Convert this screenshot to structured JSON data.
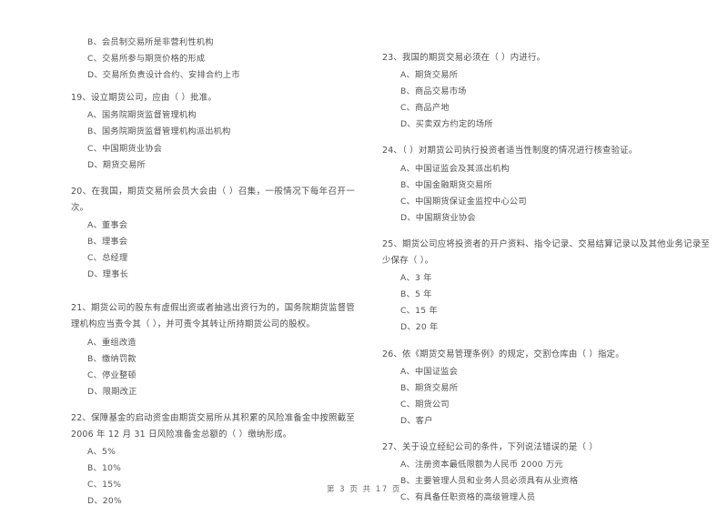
{
  "document": {
    "footer": "第 3 页 共 17 页"
  },
  "left_column": {
    "orphan_options": [
      "B、会员制交易所是非营利性机构",
      "C、交易所参与期货价格的形成",
      "D、交易所负责设计合约、安排合约上市"
    ],
    "questions": [
      {
        "number": "19",
        "stem": "19、设立期货公司，应由（      ）批准。",
        "options": [
          "A、国务院期货监督管理机构",
          "B、国务院期货监督管理机构派出机构",
          "C、中国期货业协会",
          "D、期货交易所"
        ]
      },
      {
        "number": "20",
        "stem": "20、在我国，期货交易所会员大会由（      ）召集，一般情况下每年召开一次。",
        "options": [
          "A、董事会",
          "B、理事会",
          "C、总经理",
          "D、理事长"
        ]
      },
      {
        "number": "21",
        "stem": "21、期货公司的股东有虚假出资或者抽逃出资行为的，国务院期货监督管理机构应当责令其（      ），并可责令其转让所持期货公司的股权。",
        "options": [
          "A、重组改造",
          "B、缴纳罚款",
          "C、停业整顿",
          "D、限期改正"
        ]
      },
      {
        "number": "22",
        "stem": "22、保障基金的启动资金由期货交易所从其积累的风险准备金中按照截至 2006 年 12 月 31 日风险准备金总额的（      ）缴纳形成。",
        "options": [
          "A、5%",
          "B、10%",
          "C、15%",
          "D、20%"
        ]
      }
    ]
  },
  "right_column": {
    "questions": [
      {
        "number": "23",
        "stem": "23、我国的期货交易必须在（      ）内进行。",
        "options": [
          "A、期货交易所",
          "B、商品交易市场",
          "C、商品产地",
          "D、买卖双方约定的场所"
        ]
      },
      {
        "number": "24",
        "stem": "24、（      ）对期货公司执行投资者适当性制度的情况进行核查验证。",
        "options": [
          "A、中国证监会及其派出机构",
          "B、中国金融期货交易所",
          "C、中国期货保证金监控中心公司",
          "D、中国期货业协会"
        ]
      },
      {
        "number": "25",
        "stem": "25、期货公司应将投资者的开户资料、指令记录、交易结算记录以及其他业务记录至少保存（      ）。",
        "options": [
          "A、3 年",
          "B、5 年",
          "C、15 年",
          "D、20 年"
        ]
      },
      {
        "number": "26",
        "stem": "26、依《期货交易管理条例》的规定，交割仓库由（      ）指定。",
        "options": [
          "A、中国证监会",
          "B、期货交易所",
          "C、期货公司",
          "D、客户"
        ]
      },
      {
        "number": "27",
        "stem": "27、关于设立经纪公司的条件，下列说法错误的是（      ）",
        "options": [
          "A、注册资本最低限额为人民币 2000 万元",
          "B、主要管理人员和业务人员必须具有从业资格",
          "C、有具备任职资格的高级管理人员"
        ]
      }
    ]
  }
}
